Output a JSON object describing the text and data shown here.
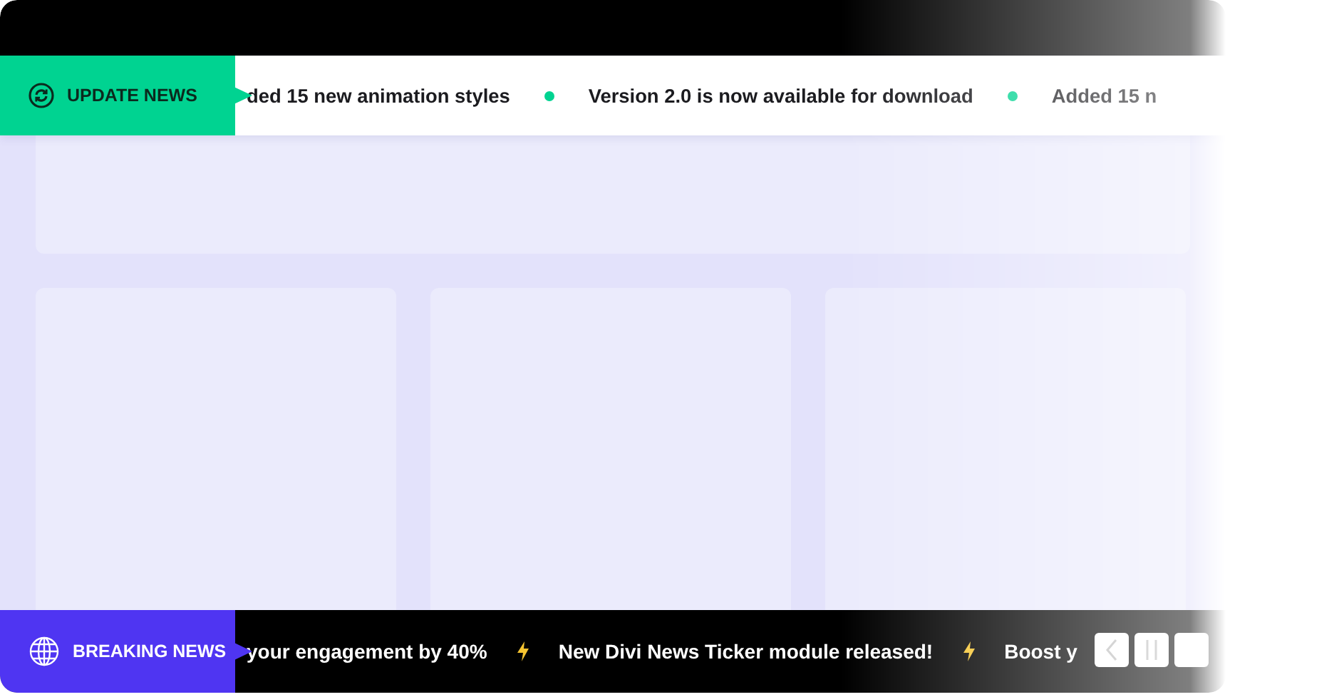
{
  "update_ticker": {
    "label": "UPDATE NEWS",
    "items": [
      "ded 15 new animation styles",
      "Version 2.0 is now available for download",
      "Added 15 n"
    ]
  },
  "breaking_ticker": {
    "label": "BREAKING NEWS",
    "items": [
      "your engagement by 40%",
      "New Divi News Ticker module released!",
      "Boost y"
    ]
  }
}
